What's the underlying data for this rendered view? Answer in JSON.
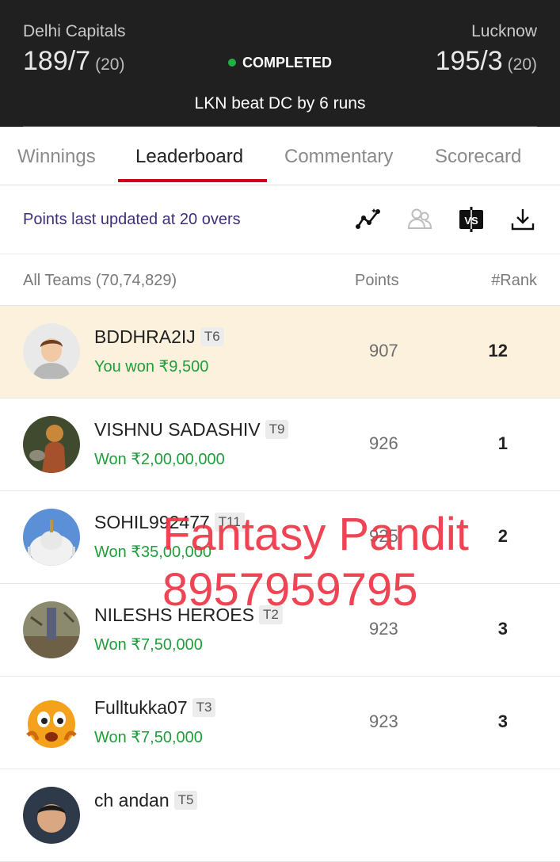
{
  "match": {
    "team_left": {
      "name": "Delhi Capitals",
      "score": "189/7",
      "overs": "(20)"
    },
    "team_right": {
      "name": "Lucknow",
      "score": "195/3",
      "overs": "(20)"
    },
    "status": "COMPLETED",
    "result": "LKN beat DC by 6 runs"
  },
  "tabs": [
    {
      "label": "Winnings"
    },
    {
      "label": "Leaderboard"
    },
    {
      "label": "Commentary"
    },
    {
      "label": "Scorecard"
    }
  ],
  "updated": {
    "text": "Points last updated at 20 overs",
    "icons": [
      "chart-icon",
      "compare-teams-icon",
      "vs-icon",
      "download-icon"
    ]
  },
  "list_header": {
    "all_teams": "All Teams (70,74,829)",
    "points": "Points",
    "rank": "#Rank"
  },
  "rows": [
    {
      "name": "BDDHRA2IJ",
      "team_tag": "T6",
      "won": "You won ₹9,500",
      "points": "907",
      "rank": "12"
    },
    {
      "name": "VISHNU SADASHIV",
      "team_tag": "T9",
      "won": "Won ₹2,00,00,000",
      "points": "926",
      "rank": "1"
    },
    {
      "name": "SOHIL992477",
      "team_tag": "T11",
      "won": "Won ₹35,00,000",
      "points": "925",
      "rank": "2"
    },
    {
      "name": "NILESHS HEROES",
      "team_tag": "T2",
      "won": "Won ₹7,50,000",
      "points": "923",
      "rank": "3"
    },
    {
      "name": "Fulltukka07",
      "team_tag": "T3",
      "won": "Won ₹7,50,000",
      "points": "923",
      "rank": "3"
    },
    {
      "name": "ch andan",
      "team_tag": "T5",
      "won": "",
      "points": "",
      "rank": ""
    }
  ],
  "watermark": {
    "line1": "Fantasy Pandit",
    "line2": "8957959795"
  },
  "colors": {
    "header_bg": "#202020",
    "accent": "#d0021b",
    "won_green": "#1f9e3a",
    "status_green": "#1fb141",
    "highlight_row": "#fbf1dd"
  }
}
